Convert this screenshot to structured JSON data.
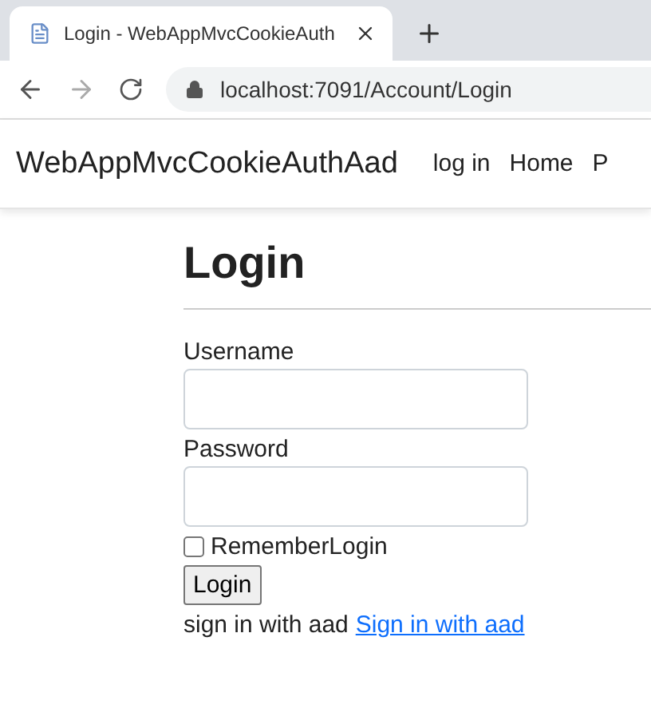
{
  "browser": {
    "tab_title": "Login - WebAppMvcCookieAuth",
    "address": "localhost:7091/Account/Login"
  },
  "navbar": {
    "brand": "WebAppMvcCookieAuthAad",
    "links": [
      {
        "label": "log in"
      },
      {
        "label": "Home"
      },
      {
        "label": "P"
      }
    ]
  },
  "page": {
    "heading": "Login",
    "fields": [
      {
        "label": "Username"
      },
      {
        "label": "Password"
      }
    ],
    "remember": {
      "label": "RememberLogin",
      "checked": false
    },
    "button": "Login",
    "aad_text": "sign in with aad",
    "aad_link": "Sign in with aad"
  }
}
